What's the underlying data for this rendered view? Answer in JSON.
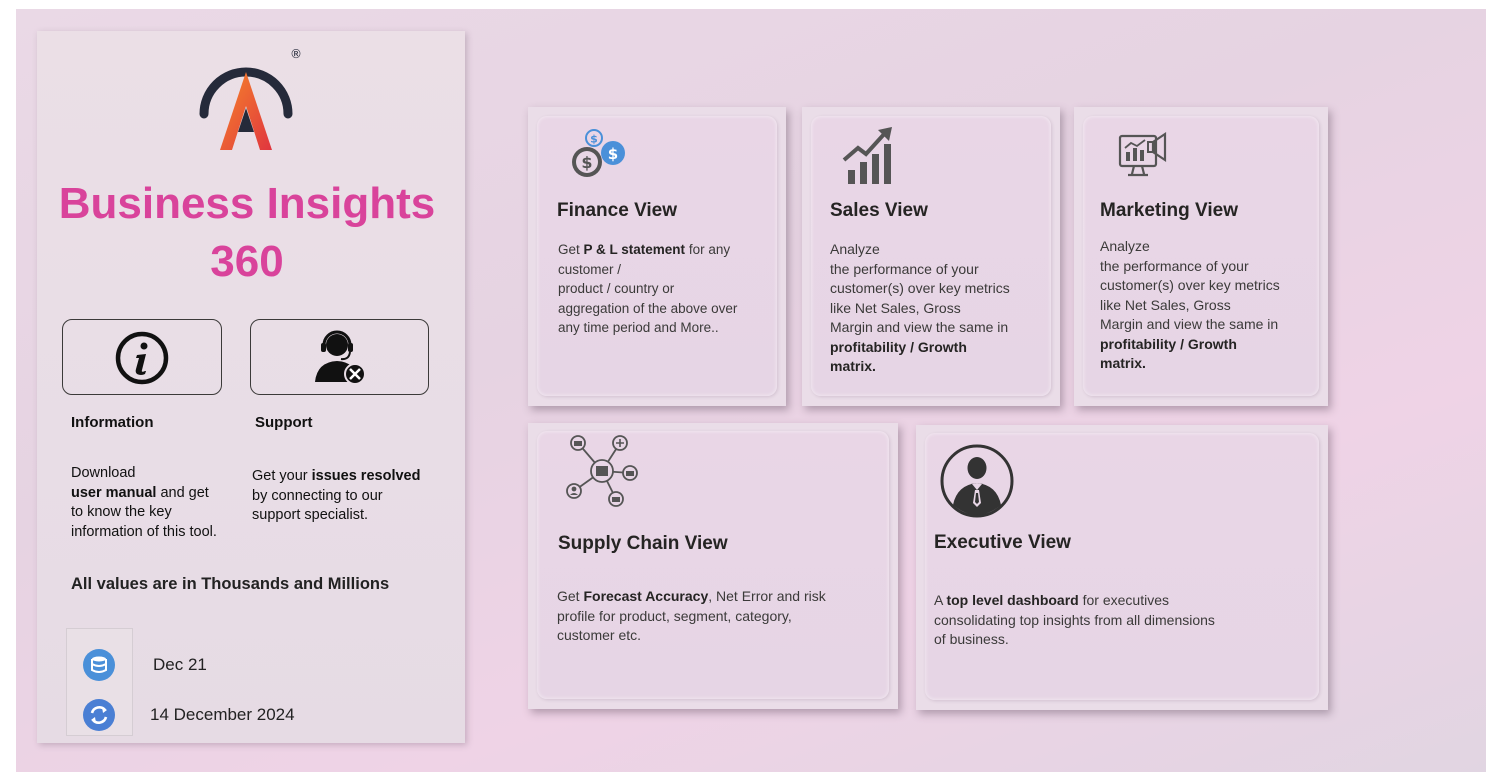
{
  "left_panel": {
    "title_line1": "Business Insights",
    "title_line2": "360",
    "information": {
      "label": "Information",
      "desc_1": "Download",
      "desc_bold": "user manual",
      "desc_2": " and get",
      "desc_3": "to know the key",
      "desc_4": "information of this tool."
    },
    "support": {
      "label": "Support",
      "desc_1": "Get your ",
      "desc_bold": "issues resolved",
      "desc_2": "by connecting to our",
      "desc_3": "support specialist."
    },
    "units_note": "All values are in Thousands and Millions",
    "data_date": "Dec 21",
    "refresh_date": "14 December 2024"
  },
  "cards": {
    "finance": {
      "title": "Finance View",
      "d1": "Get ",
      "d1_bold": "P & L statement",
      "d1_rest": " for any",
      "d2": "customer /",
      "d3": "product / country or",
      "d4": "aggregation of the above over",
      "d5": "any time period and More.."
    },
    "sales": {
      "title": "Sales View",
      "d1": "Analyze",
      "d2": "the performance of your",
      "d3": "customer(s) over key metrics",
      "d4": "like Net Sales, Gross",
      "d5": "Margin and view the same in",
      "d6_bold": "profitability / Growth",
      "d7_bold": "matrix."
    },
    "marketing": {
      "title": "Marketing View",
      "d1": "Analyze",
      "d2": "the performance of your",
      "d3": "customer(s) over key metrics",
      "d4": "like Net Sales, Gross",
      "d5": "Margin and view the same in",
      "d6_bold": "profitability / Growth",
      "d7_bold": "matrix."
    },
    "supply_chain": {
      "title": "Supply Chain View",
      "d1": "Get ",
      "d1_bold": "Forecast Accuracy",
      "d1_rest": ", Net Error and risk",
      "d2": "profile for product, segment, category,",
      "d3": "customer etc."
    },
    "executive": {
      "title": "Executive View",
      "d1": "A ",
      "d1_bold": "top level dashboard",
      "d1_rest": " for executives",
      "d2": "consolidating top insights from all dimensions",
      "d3": "of business."
    }
  },
  "colors": {
    "title_pink": "#d9439b",
    "logo_dark": "#252a3a",
    "logo_orange": "#f26b2e",
    "logo_red": "#e03c45",
    "icon_blue": "#4a90d9"
  }
}
